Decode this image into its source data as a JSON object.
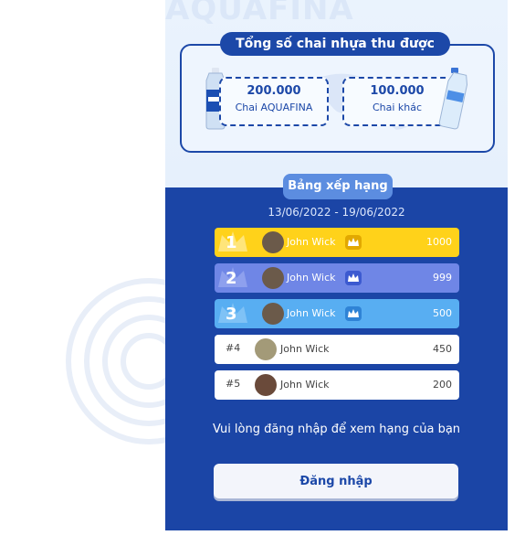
{
  "brand_watermark": "AQUAFINA",
  "totals": {
    "title": "Tổng số chai nhựa thu được",
    "aquafina": {
      "value": "200.000",
      "label": "Chai AQUAFINA"
    },
    "other": {
      "value": "100.000",
      "label": "Chai khác"
    }
  },
  "ranking": {
    "title": "Bảng xếp hạng",
    "date_range": "13/06/2022 - 19/06/2022",
    "rows": [
      {
        "rank": "1",
        "name": "John Wick",
        "score": "1000"
      },
      {
        "rank": "2",
        "name": "John Wick",
        "score": "999"
      },
      {
        "rank": "3",
        "name": "John Wick",
        "score": "500"
      },
      {
        "rank": "#4",
        "name": "John Wick",
        "score": "450"
      },
      {
        "rank": "#5",
        "name": "John Wick",
        "score": "200"
      }
    ]
  },
  "notice": "Vui lòng đăng nhập để xem hạng của bạn",
  "login_button": "Đăng nhập",
  "colors": {
    "primary": "#1b45a6",
    "gold": "#ffd21a",
    "silver_row": "#6f86e6",
    "bronze_row": "#58aef2"
  }
}
